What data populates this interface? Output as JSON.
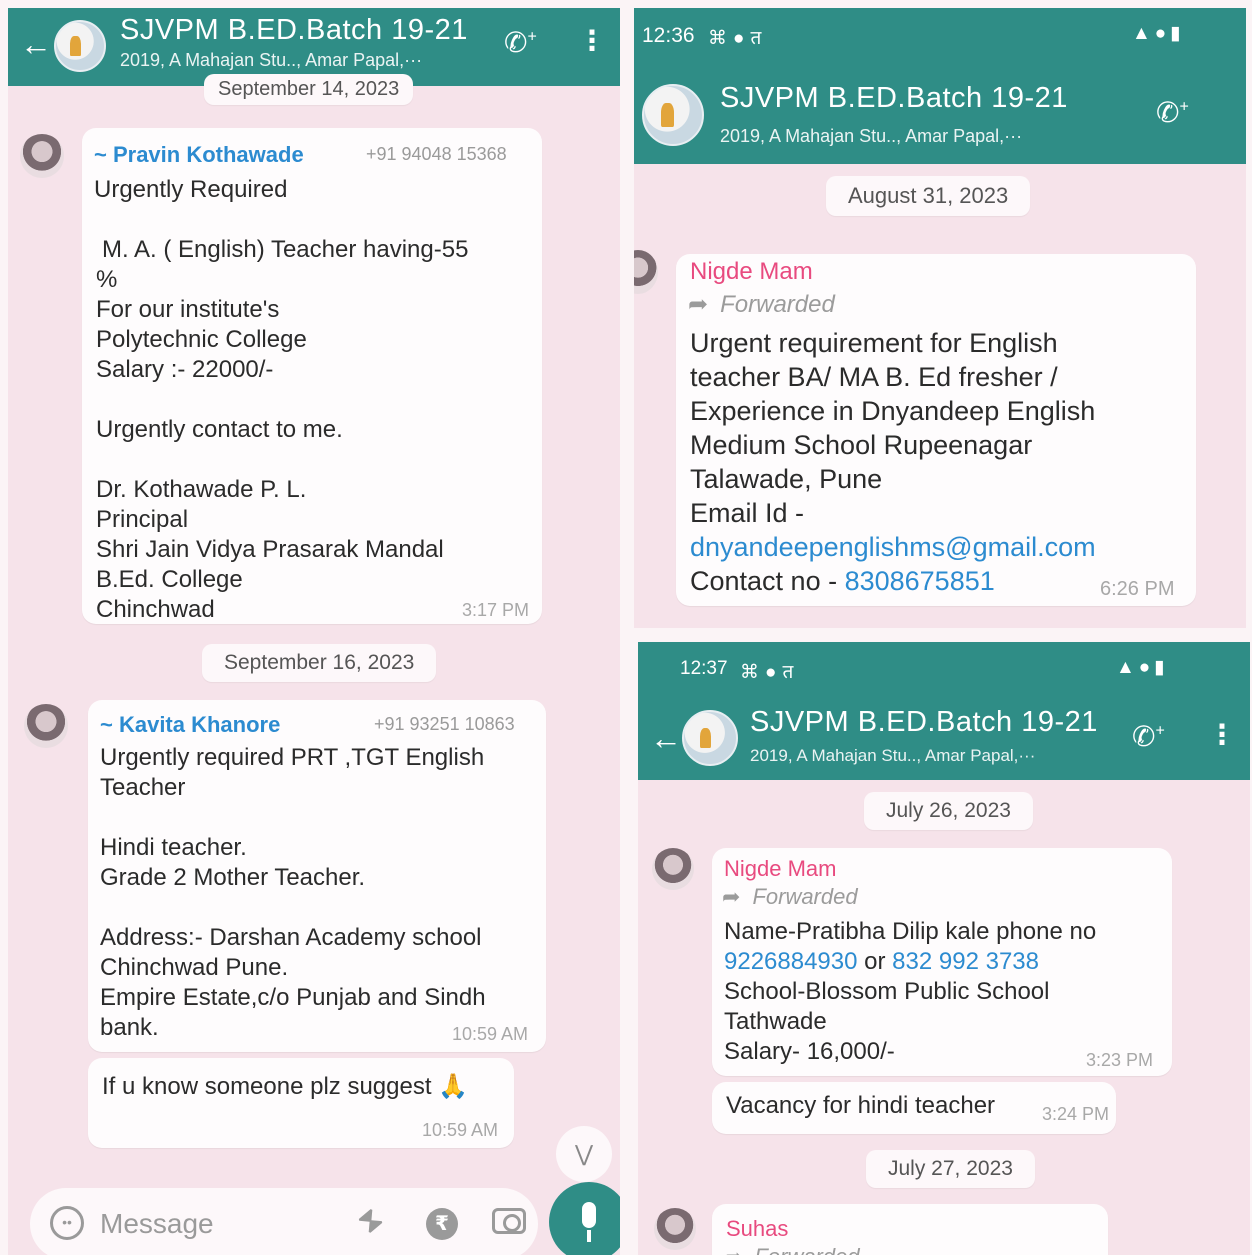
{
  "group": {
    "title": "SJVPM B.ED.Batch 19-21",
    "subtitle": "2019, A Mahajan Stu.., Amar Papal,···"
  },
  "icons": {
    "back": "arrow-left-icon",
    "call": "add-call-icon",
    "menu": "kebab-menu-icon",
    "emoji": "emoji-icon",
    "attach": "paperclip-icon",
    "payment": "rupee-icon",
    "camera": "camera-icon",
    "mic": "microphone-icon",
    "scroll": "double-chevron-down-icon"
  },
  "colors": {
    "header": "#2f8d86",
    "chat_bg": "#f6e3ea",
    "link": "#2c8bd0",
    "sender_blue": "#2c8bd0",
    "sender_pink": "#e84a7f"
  },
  "left": {
    "date_partial": "September 14, 2023",
    "msg1": {
      "sender": "~ Pravin Kothawade",
      "phone": "+91 94048 15368",
      "lines": [
        "Urgently Required",
        "M. A. ( English) Teacher having-55",
        "%",
        "For our institute's",
        "Polytechnic College",
        "Salary :- 22000/-",
        "Urgently contact to me.",
        "Dr. Kothawade P. L.",
        "Principal",
        "Shri Jain Vidya Prasarak Mandal",
        "B.Ed. College",
        "Chinchwad"
      ],
      "time": "3:17 PM"
    },
    "date2": "September 16, 2023",
    "msg2": {
      "sender": "~ Kavita Khanore",
      "phone": "+91 93251 10863",
      "lines": [
        "Urgently required PRT ,TGT English",
        "Teacher",
        "Hindi teacher.",
        "Grade 2  Mother Teacher.",
        "Address:- Darshan Academy school",
        "Chinchwad Pune.",
        "Empire Estate,c/o Punjab and Sindh",
        "bank."
      ],
      "time": "10:59 AM"
    },
    "msg3": {
      "text": "If u know someone plz suggest 🙏",
      "time": "10:59 AM"
    },
    "composer_placeholder": "Message"
  },
  "top_right": {
    "status_time": "12:36",
    "date": "August 31, 2023",
    "msg": {
      "sender": "Nigde Mam",
      "forwarded": "Forwarded",
      "lines": [
        "Urgent requirement for English",
        "teacher BA/ MA B. Ed  fresher /",
        "Experience in Dnyandeep English",
        "Medium School Rupeenagar",
        "Talawade, Pune",
        "Email Id -"
      ],
      "email": "dnyandeepenglishms@gmail.com",
      "contact_label": "Contact no - ",
      "contact_number": "8308675851",
      "time": "6:26 PM"
    }
  },
  "bottom_right": {
    "status_time": "12:37",
    "date1": "July 26, 2023",
    "msg1": {
      "sender": "Nigde Mam",
      "forwarded": "Forwarded",
      "line1": "Name-Pratibha Dilip kale  phone no",
      "phone1": "9226884930",
      "or": " or ",
      "phone2": "832 992 3738",
      "lines": [
        "School-Blossom Public School",
        "Tathwade",
        "Salary- 16,000/-"
      ],
      "time": "3:23 PM"
    },
    "msg2": {
      "text": "Vacancy for hindi teacher",
      "time": "3:24 PM"
    },
    "date2": "July 27, 2023",
    "msg3": {
      "sender": "Suhas",
      "forwarded": "Forwarded"
    }
  }
}
